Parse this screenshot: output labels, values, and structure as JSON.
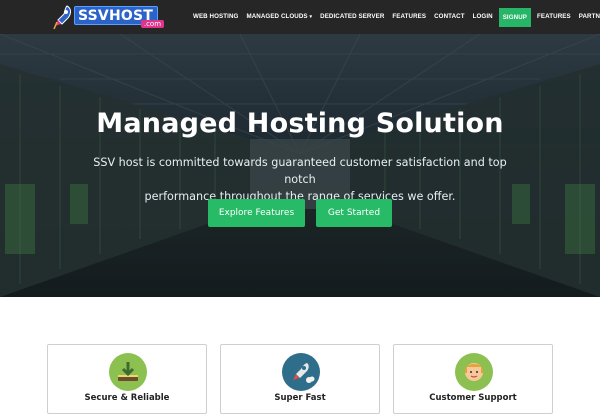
{
  "brand": {
    "name": "SSVHOST",
    "domain_suffix": ".com"
  },
  "nav": {
    "items": [
      {
        "label": "WEB HOSTING"
      },
      {
        "label": "MANAGED CLOUDS",
        "has_dropdown": true
      },
      {
        "label": "DEDICATED SERVER"
      },
      {
        "label": "FEATURES"
      },
      {
        "label": "CONTACT"
      },
      {
        "label": "LOGIN"
      },
      {
        "label": "SIGNUP",
        "highlight": true
      },
      {
        "label": "FEATURES"
      },
      {
        "label": "PARTNERS"
      }
    ]
  },
  "hero": {
    "title": "Managed Hosting Solution",
    "subtitle_line1": "SSV host is committed towards guaranteed customer satisfaction and top notch",
    "subtitle_line2": "performance throughout the range of services we offer.",
    "buttons": {
      "explore": "Explore Features",
      "start": "Get Started"
    }
  },
  "features": {
    "cards": [
      {
        "title": "Secure & Reliable",
        "icon": "download-icon"
      },
      {
        "title": "Super Fast",
        "icon": "rocket-icon"
      },
      {
        "title": "Customer Support",
        "icon": "support-agent-icon"
      }
    ]
  },
  "colors": {
    "navbar": "#262626",
    "accent_green": "#27ba67",
    "card_border": "#cfcfcf",
    "card_icon_1": "#8cc152",
    "card_icon_2": "#2f6e8a",
    "card_icon_3": "#8cc152"
  }
}
